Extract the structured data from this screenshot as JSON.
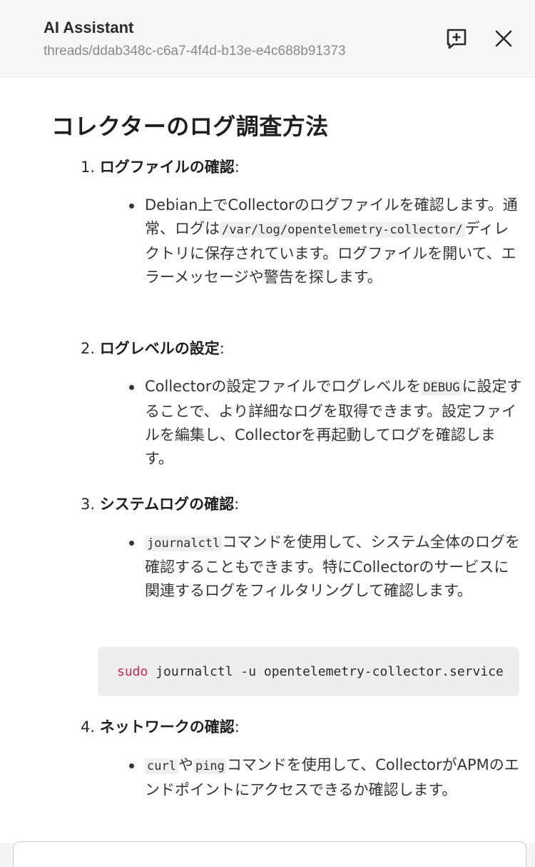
{
  "header": {
    "title": "AI Assistant",
    "thread_path": "threads/ddab348c-c6a7-4f4d-b13e-e4c688b91373",
    "new_thread_icon": "new-thread-icon",
    "close_icon": "close-icon"
  },
  "message": {
    "heading": "コレクターのログ調査方法",
    "steps": [
      {
        "number": "1.",
        "title": "ログファイルの確認",
        "colon": ":",
        "bullet": [
          {
            "t": "Debian上でCollectorのログファイルを確認します。通常、ログは"
          },
          {
            "c": "/var/log/opentelemetry-collector/"
          },
          {
            "t": "ディレクトリに保存されています。ログファイルを開いて、エラーメッセージや警告を探します。"
          }
        ]
      },
      {
        "number": "2.",
        "title": "ログレベルの設定",
        "colon": ":",
        "bullet": [
          {
            "t": "Collectorの設定ファイルでログレベルを"
          },
          {
            "c": "DEBUG"
          },
          {
            "t": "に設定することで、より詳細なログを取得できます。設定ファイルを編集し、Collectorを再起動してログを確認します。"
          }
        ]
      },
      {
        "number": "3.",
        "title": "システムログの確認",
        "colon": ":",
        "bullet": [
          {
            "c": "journalctl"
          },
          {
            "t": "コマンドを使用して、システム全体のログを確認することもできます。特にCollectorのサービスに関連するログをフィルタリングして確認します。"
          }
        ]
      },
      {
        "number": "4.",
        "title": "ネットワークの確認",
        "colon": ":",
        "bullet": [
          {
            "c": "curl"
          },
          {
            "t": "や"
          },
          {
            "c": "ping"
          },
          {
            "t": "コマンドを使用して、CollectorがAPMのエンドポイントにアクセスできるか確認します。"
          }
        ]
      }
    ],
    "code": {
      "keyword": "sudo",
      "rest": " journalctl -u opentelemetry-collector.service"
    }
  },
  "colors": {
    "header_bg": "#f6f6f6",
    "code_keyword": "#c8284a",
    "code_bg": "#eeeeee"
  }
}
